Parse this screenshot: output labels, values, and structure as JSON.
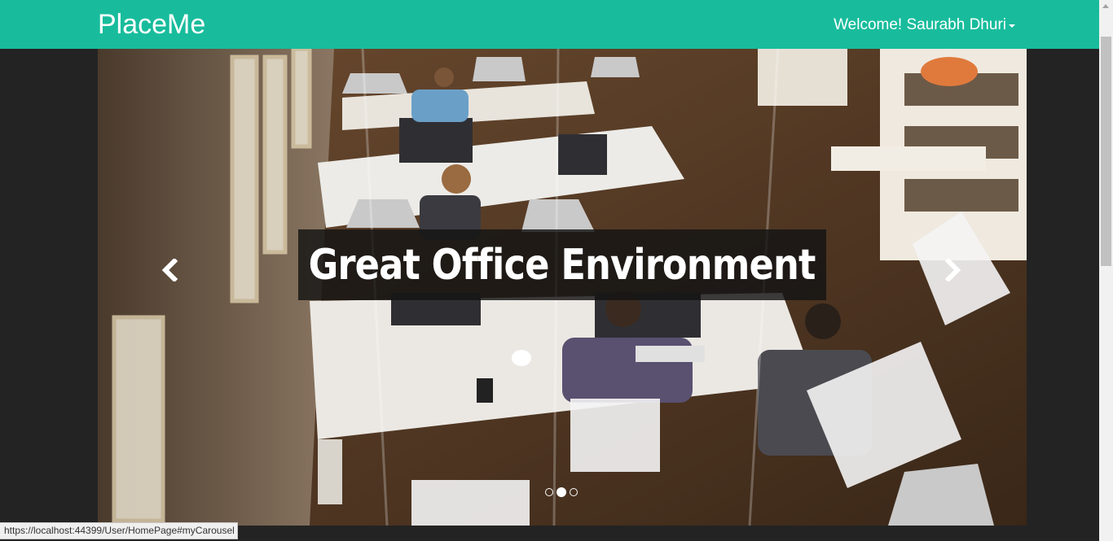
{
  "navbar": {
    "brand": "PlaceMe",
    "user_menu_label": "Welcome! Saurabh Dhuri"
  },
  "carousel": {
    "caption": "Great Office Environment",
    "indicators": [
      {
        "active": false
      },
      {
        "active": true
      },
      {
        "active": false
      }
    ],
    "prev_icon": "chevron-left-icon",
    "next_icon": "chevron-right-icon"
  },
  "statusbar": {
    "url": "https://localhost:44399/User/HomePage#myCarousel"
  },
  "colors": {
    "navbar_bg": "#18bc9c",
    "page_bg": "#232323",
    "caption_bg": "rgba(20,20,20,0.82)"
  }
}
